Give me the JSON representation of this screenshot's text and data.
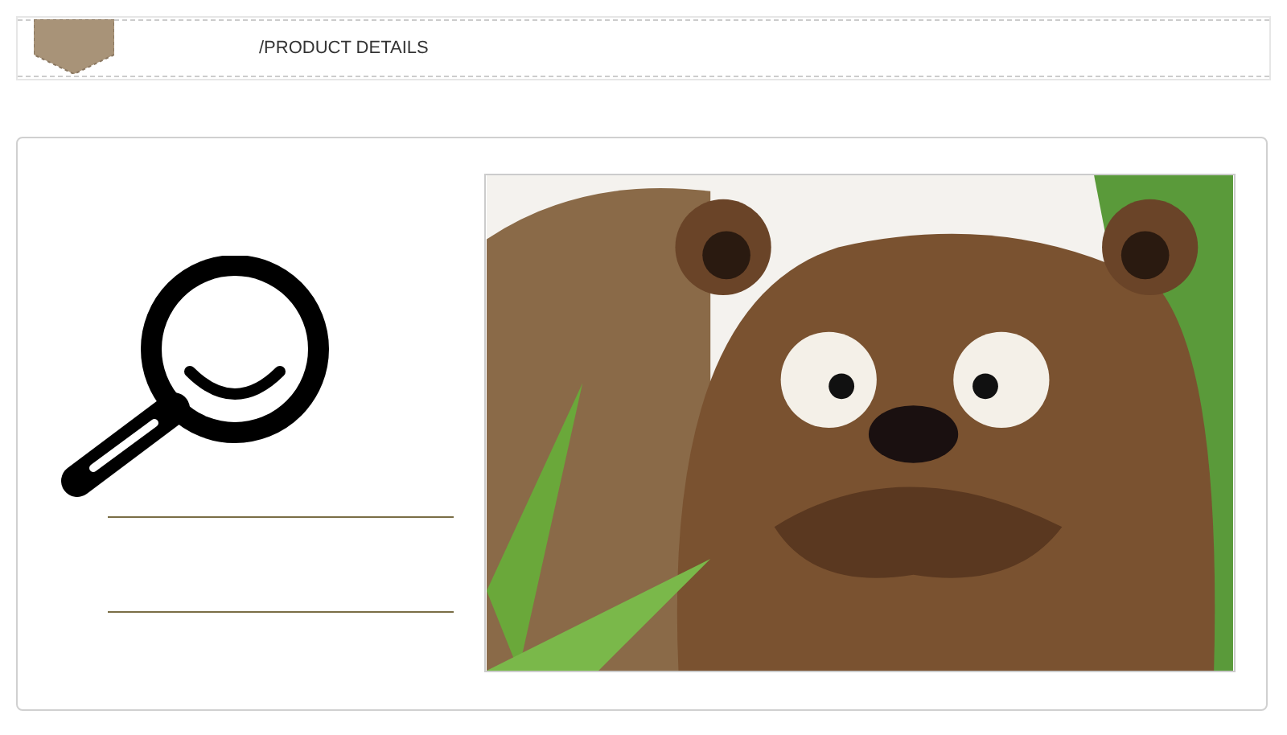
{
  "header": {
    "title": "/PRODUCT DETAILS"
  }
}
